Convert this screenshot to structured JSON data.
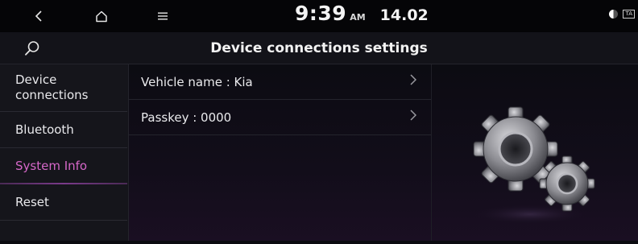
{
  "status_bar": {
    "time": "9:39",
    "ampm": "AM",
    "date": "14.02",
    "back_icon": "back-arrow-icon",
    "home_icon": "home-icon",
    "menu_icon": "menu-icon",
    "right_icons": [
      "display-mode-icon",
      "ta-icon"
    ],
    "ta_label": "TA"
  },
  "header": {
    "title": "Device connections settings",
    "search_icon": "search-icon"
  },
  "sidebar": {
    "items": [
      {
        "label": "Device connections",
        "active": false
      },
      {
        "label": "Bluetooth",
        "active": false
      },
      {
        "label": "System Info",
        "active": true
      },
      {
        "label": "Reset",
        "active": false
      }
    ]
  },
  "main": {
    "rows": [
      {
        "label": "Vehicle name : Kia"
      },
      {
        "label": "Passkey : 0000"
      }
    ],
    "illustration_icon": "gears-icon"
  },
  "colors": {
    "accent": "#d567c8",
    "background": "#0b0b10",
    "panel": "#15151b"
  }
}
